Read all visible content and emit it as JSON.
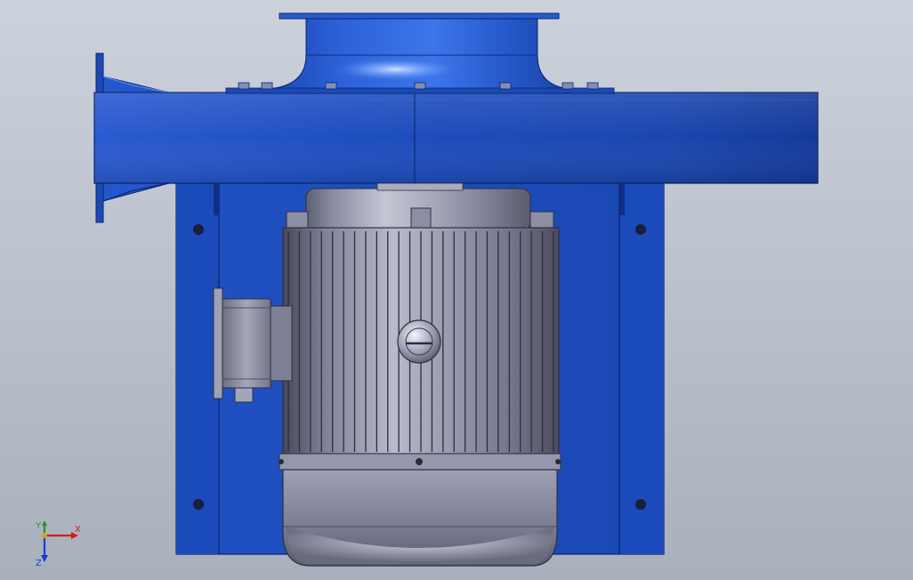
{
  "viewport": {
    "background_top": "#c9cfd9",
    "background_bottom": "#a9b1bd"
  },
  "colors": {
    "housing_blue": "#1e4fc0",
    "housing_blue_dark": "#123a99",
    "housing_blue_light": "#3a72e8",
    "motor_grey": "#7a7d92",
    "motor_grey_light": "#c7c8d6",
    "motor_grey_dark": "#4a4c5c",
    "axis_x": "#d21a1a",
    "axis_y": "#1a9a2a",
    "axis_z": "#1a3ad2"
  },
  "triad": {
    "x_label": "X",
    "y_label": "Y",
    "z_label": "Z",
    "icon": "coordinate-triad-icon"
  }
}
